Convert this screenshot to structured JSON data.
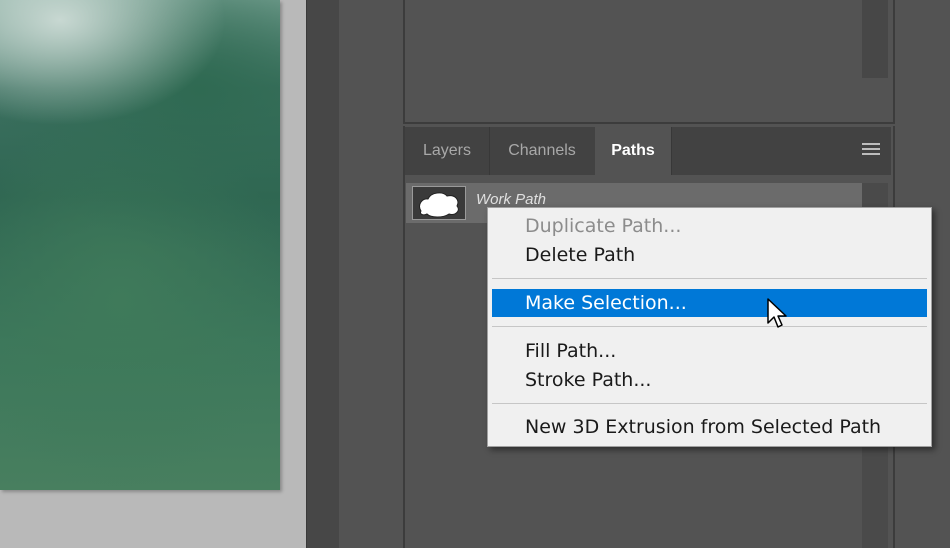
{
  "tabs": [
    {
      "label": "Layers",
      "active": false
    },
    {
      "label": "Channels",
      "active": false
    },
    {
      "label": "Paths",
      "active": true
    }
  ],
  "path_item": {
    "name": "Work Path"
  },
  "context_menu": {
    "items": [
      {
        "label": "Duplicate Path...",
        "state": "disabled"
      },
      {
        "label": "Delete Path",
        "state": "normal"
      },
      {
        "label": "Make Selection...",
        "state": "highlighted"
      },
      {
        "label": "Fill Path...",
        "state": "normal"
      },
      {
        "label": "Stroke Path...",
        "state": "normal"
      },
      {
        "label": "New 3D Extrusion from Selected Path",
        "state": "normal"
      }
    ]
  },
  "colors": {
    "panel_bg": "#535353",
    "menu_bg": "#f0f0f0",
    "highlight": "#0078d7"
  },
  "icons": [
    "panel-menu-icon",
    "path-thumbnail-icon",
    "mouse-cursor-icon"
  ]
}
